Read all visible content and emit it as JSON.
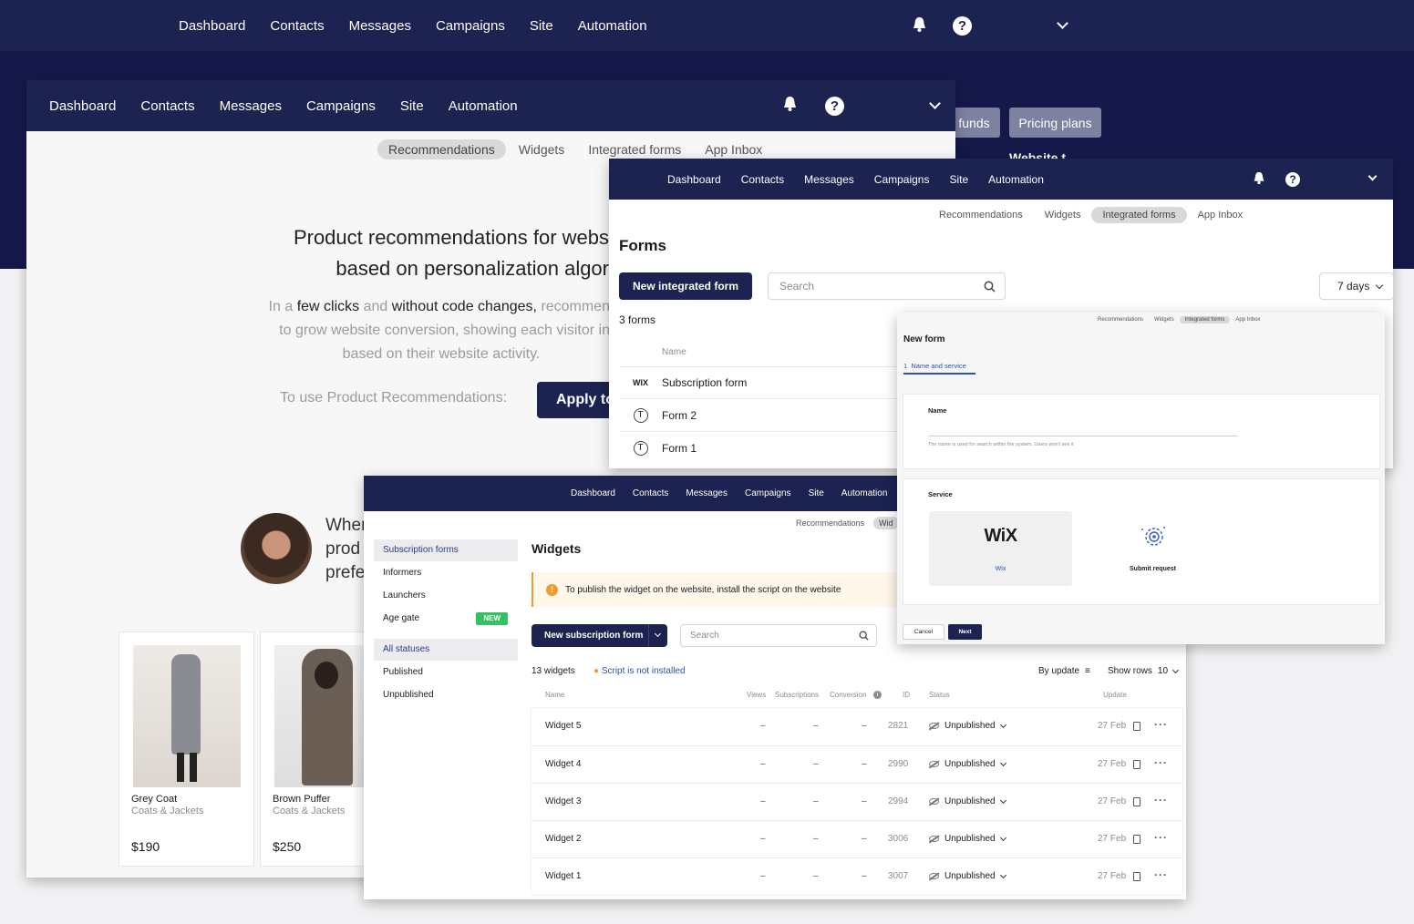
{
  "nav": {
    "items": [
      "Dashboard",
      "Contacts",
      "Messages",
      "Campaigns",
      "Site",
      "Automation"
    ]
  },
  "bg": {
    "add_funds": "funds",
    "pricing": "Pricing plans",
    "partial": "Website t"
  },
  "tabs": [
    "Recommendations",
    "Widgets",
    "Integrated forms",
    "App Inbox"
  ],
  "reco": {
    "heading1": "Product recommendations for websit",
    "heading2": "based on personalization algorit",
    "p1a": "In a",
    "p1b": "few clicks",
    "p1c": "and",
    "p1d": "without code changes,",
    "p1e": "recommen",
    "p2": "to grow website conversion, showing each visitor in",
    "p3": "based on their website activity.",
    "use_label": "To use Product Recommendations:",
    "apply_btn": "Apply to",
    "quote1": "When",
    "quote2": "prod",
    "quote3": "prefe",
    "products": [
      {
        "name": "Grey Coat",
        "cat": "Coats & Jackets",
        "price": "$190"
      },
      {
        "name": "Brown Puffer",
        "cat": "Coats & Jackets",
        "price": "$250"
      }
    ]
  },
  "forms": {
    "title": "Forms",
    "new_btn": "New integrated form",
    "search_ph": "Search",
    "period": "7 days",
    "count": "3 forms",
    "col_name": "Name",
    "rows": [
      {
        "icon": "WIX",
        "name": "Subscription form"
      },
      {
        "icon": "T",
        "name": "Form 2"
      },
      {
        "icon": "T",
        "name": "Form 1"
      }
    ]
  },
  "newform": {
    "title": "New form",
    "step": "1",
    "step_label": "Name and service",
    "name_label": "Name",
    "name_hint": "The name is used for search within the system. Users won't see it",
    "service_label": "Service",
    "wix_logo": "WiX",
    "wix": "Wix",
    "submit": "Submit request",
    "cancel": "Cancel",
    "next": "Next"
  },
  "widgets": {
    "sidebar": [
      "Subscription forms",
      "Informers",
      "Launchers",
      "Age gate"
    ],
    "new_badge": "NEW",
    "statuses": [
      "All statuses",
      "Published",
      "Unpublished"
    ],
    "title": "Widgets",
    "alert": "To publish the widget on the website, install the script on the website",
    "new_btn": "New subscription form",
    "search_ph": "Search",
    "count": "13 widgets",
    "script": "Script is not installed",
    "sort": "By update",
    "show_rows": "Show rows",
    "rows_n": "10",
    "cols": [
      "Name",
      "Views",
      "Subscriptions",
      "Conversion",
      "ID",
      "Status",
      "Update"
    ],
    "tab_reco": "Recommendations",
    "tab_wid": "Wid",
    "rows": [
      {
        "name": "Widget 5",
        "views": "–",
        "subs": "–",
        "conv": "–",
        "id": "2821",
        "status": "Unpublished",
        "date": "27 Feb"
      },
      {
        "name": "Widget 4",
        "views": "–",
        "subs": "–",
        "conv": "–",
        "id": "2990",
        "status": "Unpublished",
        "date": "27 Feb"
      },
      {
        "name": "Widget 3",
        "views": "–",
        "subs": "–",
        "conv": "–",
        "id": "2994",
        "status": "Unpublished",
        "date": "27 Feb"
      },
      {
        "name": "Widget 2",
        "views": "–",
        "subs": "–",
        "conv": "–",
        "id": "3006",
        "status": "Unpublished",
        "date": "27 Feb"
      },
      {
        "name": "Widget 1",
        "views": "–",
        "subs": "–",
        "conv": "–",
        "id": "3007",
        "status": "Unpublished",
        "date": "27 Feb"
      }
    ]
  }
}
